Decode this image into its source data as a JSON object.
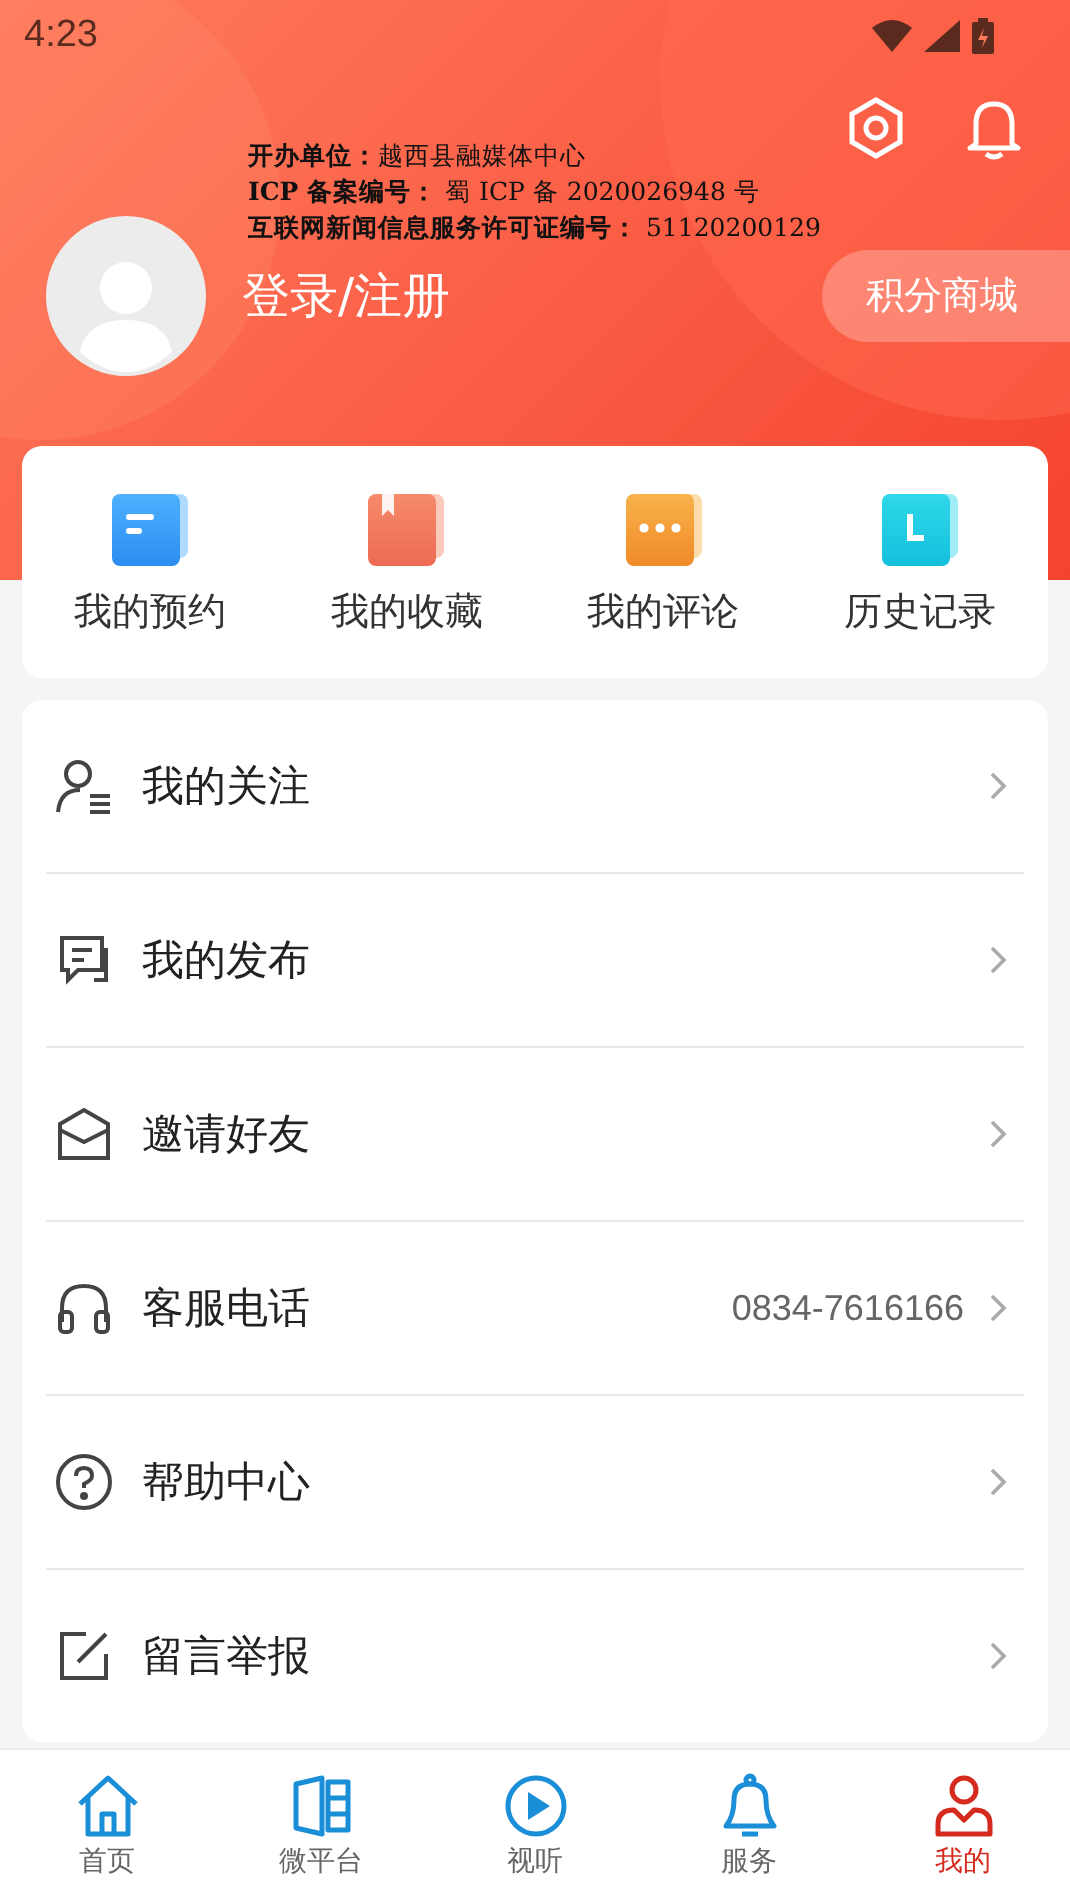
{
  "status_bar": {
    "time": "4:23"
  },
  "license": [
    "**开办单位：**越西县融媒体中心",
    "**ICP 备案编号：** 蜀 ICP 备 2020026948 号",
    "**互联网新闻信息服务许可证编号：** 51120200129"
  ],
  "profile": {
    "login": "登录/注册",
    "points_button": "积分商城"
  },
  "shortcuts": [
    {
      "label": "我的预约",
      "kind": "file"
    },
    {
      "label": "我的收藏",
      "kind": "book"
    },
    {
      "label": "我的评论",
      "kind": "comment"
    },
    {
      "label": "历史记录",
      "kind": "history"
    }
  ],
  "menu": [
    {
      "label": "我的关注",
      "kind": "follow"
    },
    {
      "label": "我的发布",
      "kind": "publish"
    },
    {
      "label": "邀请好友",
      "kind": "invite"
    },
    {
      "label": "客服电话",
      "kind": "phone",
      "value": "0834-7616166"
    },
    {
      "label": "帮助中心",
      "kind": "help"
    },
    {
      "label": "留言举报",
      "kind": "report"
    }
  ],
  "tab_bar": [
    {
      "label": "首页",
      "kind": "home",
      "selected": false
    },
    {
      "label": "微平台",
      "kind": "platform",
      "selected": false
    },
    {
      "label": "视听",
      "kind": "play",
      "selected": false
    },
    {
      "label": "服务",
      "kind": "bell",
      "selected": false
    },
    {
      "label": "我的",
      "kind": "me",
      "selected": true
    }
  ]
}
